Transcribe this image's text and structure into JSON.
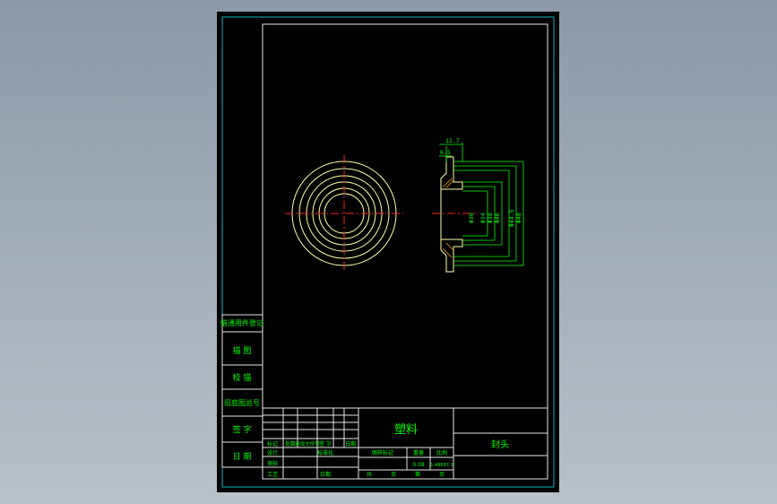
{
  "colors": {
    "background": "#000000",
    "frame": "#e6e6e6",
    "border": "#00b4c8",
    "text": "#00ff00",
    "part": "#ffffaa",
    "centerline": "#ff2020",
    "dimension": "#00ff00"
  },
  "drawing": {
    "dimensions": {
      "width_top": "12.7",
      "width_inner": "6.5",
      "diameters": [
        "Φ30",
        "Φ34",
        "Φ38",
        "Φ40",
        "Φ44.5",
        "Φ48"
      ]
    }
  },
  "left_strip": {
    "items": [
      "借通用件登记",
      "描 图",
      "校 描",
      "旧底图总号",
      "签 字",
      "日 期"
    ]
  },
  "title_block": {
    "material": "塑料",
    "part_name": "封头",
    "rev_labels": [
      "标记",
      "处数",
      "更改文件号",
      "签 字",
      "日期"
    ],
    "sign_labels": [
      "设计",
      "标准化",
      "审核",
      "工艺",
      "日期"
    ],
    "stage_labels": [
      "图样标记",
      "重量",
      "比例"
    ],
    "weight": "0.08",
    "scale": "1.49697:1",
    "sheet_labels": [
      "共",
      "页",
      "第",
      "页"
    ]
  }
}
